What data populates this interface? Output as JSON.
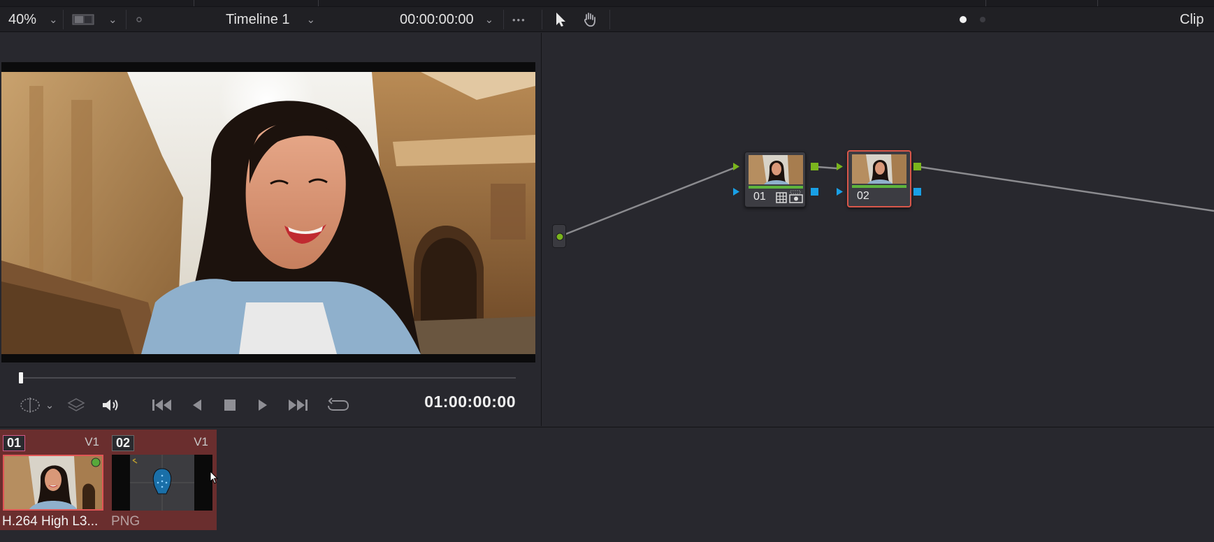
{
  "toolbar": {
    "zoom": "40%",
    "timeline_name": "Timeline 1",
    "timecode": "00:00:00:00",
    "more": "•••",
    "mode_label": "Clip"
  },
  "viewer": {
    "timecode": "01:00:00:00",
    "playhead_progress": 0
  },
  "node_graph": {
    "nodes": [
      {
        "label": "01",
        "selected": false
      },
      {
        "label": "02",
        "selected": true
      }
    ],
    "colors": {
      "rgb_port": "#7ab51d",
      "alpha_port": "#19a0e6",
      "selected_border": "#d9574a"
    }
  },
  "clips": [
    {
      "index": "01",
      "track": "V1",
      "label": "H.264 High L3..."
    },
    {
      "index": "02",
      "track": "V1",
      "label": "PNG"
    }
  ]
}
